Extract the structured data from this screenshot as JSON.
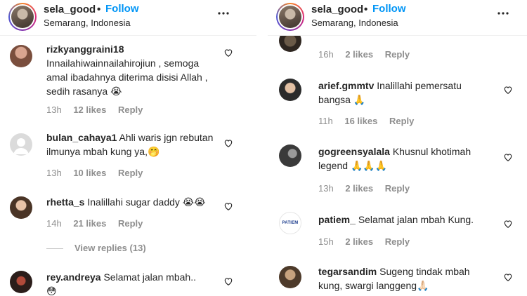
{
  "post": {
    "username": "sela_good",
    "separator": "•",
    "follow_label": "Follow",
    "location": "Semarang, Indonesia",
    "more_glyph": "•••"
  },
  "left_comments": [
    {
      "user": "rizkyanggraini18",
      "text": "Innailahiwainnailahirojiun , semoga amal ibadahnya diterima disisi Allah , sedih rasanya",
      "emoji": "😭",
      "time": "13h",
      "likes": "12 likes",
      "reply": "Reply"
    },
    {
      "user": "bulan_cahaya1",
      "text": "Ahli waris jgn rebutan ilmunya mbah kung ya,",
      "emoji": "🤭",
      "time": "13h",
      "likes": "10 likes",
      "reply": "Reply"
    },
    {
      "user": "rhetta_s",
      "text": "Inalillahi sugar daddy",
      "emoji": "😭😭",
      "time": "14h",
      "likes": "21 likes",
      "reply": "Reply"
    },
    {
      "user": "rey.andreya",
      "text": "Selamat jalan mbah..",
      "emoji": "😳",
      "time": "",
      "likes": "",
      "reply": ""
    }
  ],
  "view_replies": "View replies (13)",
  "right_top_meta": {
    "time": "16h",
    "likes": "2 likes",
    "reply": "Reply"
  },
  "right_comments": [
    {
      "user": "arief.gmmtv",
      "text": "Inalillahi pemersatu bangsa",
      "emoji": "🙏",
      "time": "11h",
      "likes": "16 likes",
      "reply": "Reply"
    },
    {
      "user": "gogreensyalala",
      "text": "Khusnul khotimah legend",
      "emoji": "🙏🙏🙏",
      "time": "13h",
      "likes": "2 likes",
      "reply": "Reply"
    },
    {
      "user": "patiem_",
      "text": "Selamat jalan mbah Kung.",
      "emoji": "",
      "time": "15h",
      "likes": "2 likes",
      "reply": "Reply",
      "avatar_text": "PATIEM"
    },
    {
      "user": "tegarsandim",
      "text": "Sugeng tindak mbah kung, swargi langgeng",
      "emoji": "🙏🏻",
      "time": "",
      "likes": "",
      "reply": ""
    }
  ],
  "colors": {
    "follow": "#0095f6",
    "meta": "#8e8e8e",
    "text": "#262626",
    "divider": "#efefef"
  },
  "icons": {
    "heart": "heart-outline-icon",
    "more": "more-horizontal-icon"
  }
}
